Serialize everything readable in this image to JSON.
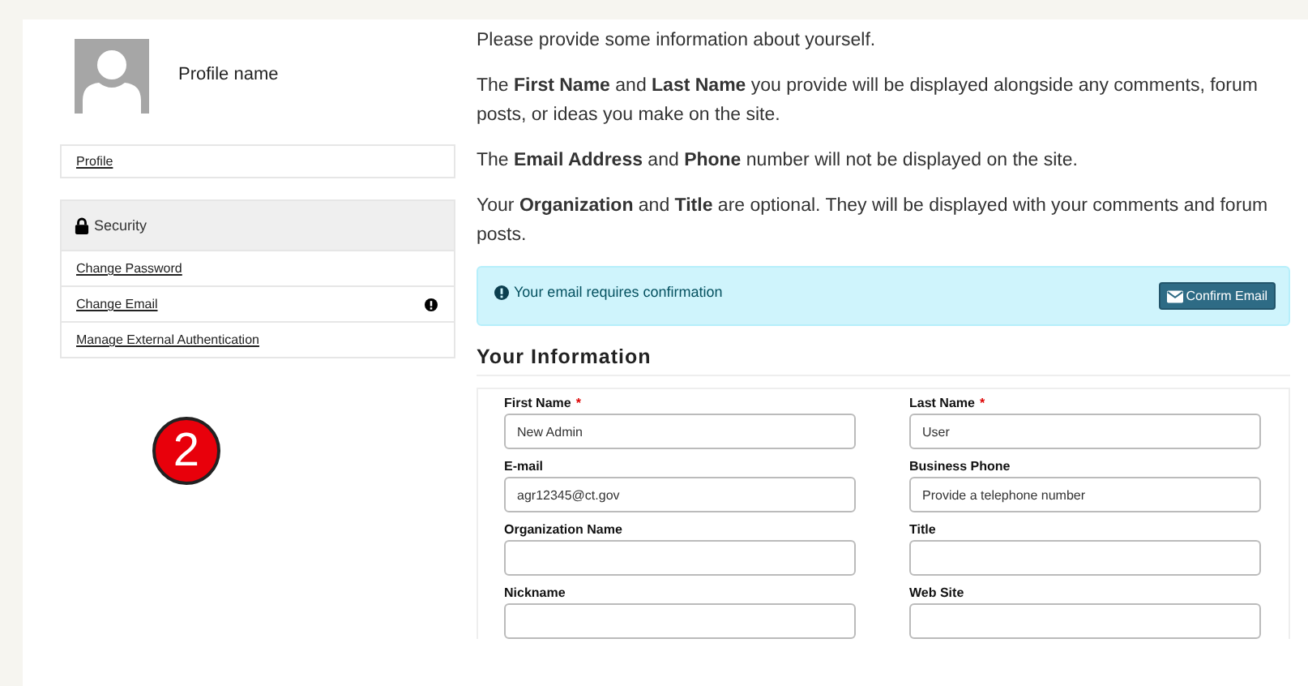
{
  "profile": {
    "name": "Profile name"
  },
  "sidebar": {
    "profile_link": "Profile",
    "security": {
      "title": "Security",
      "items": [
        {
          "label": "Change Password",
          "alert": false
        },
        {
          "label": "Change Email",
          "alert": true
        },
        {
          "label": "Manage External Authentication",
          "alert": false
        }
      ]
    }
  },
  "callout": "2",
  "intro": [
    "Please provide some information about yourself.",
    "The **First Name** and **Last Name** you provide will be displayed alongside any comments, forum posts, or ideas you make on the site.",
    "The **Email Address** and **Phone** number will not be displayed on the site.",
    "Your **Organization** and **Title** are optional. They will be displayed with your comments and forum posts."
  ],
  "alert": {
    "message": "Your email requires confirmation",
    "button": "Confirm Email"
  },
  "section_title": "Your Information",
  "required_symbol": "*",
  "fields": [
    {
      "label": "First Name",
      "required": true,
      "value": "New Admin"
    },
    {
      "label": "Last Name",
      "required": true,
      "value": "User"
    },
    {
      "label": "E-mail",
      "required": false,
      "value": "agr12345@ct.gov"
    },
    {
      "label": "Business Phone",
      "required": false,
      "placeholder": "Provide a telephone number"
    },
    {
      "label": "Organization Name",
      "required": false
    },
    {
      "label": "Title",
      "required": false
    },
    {
      "label": "Nickname",
      "required": false
    },
    {
      "label": "Web Site",
      "required": false
    }
  ]
}
